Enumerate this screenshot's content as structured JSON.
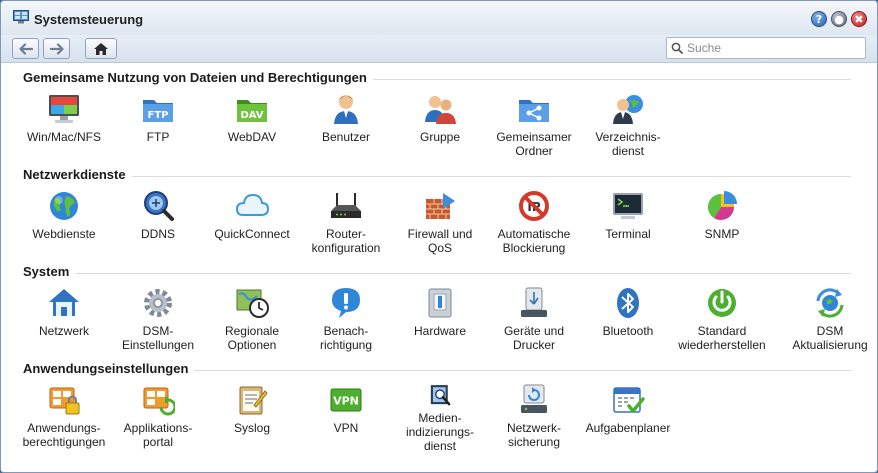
{
  "window": {
    "title": "Systemsteuerung",
    "help_glyph": "?",
    "minimize_glyph": "●",
    "close_glyph": "✖"
  },
  "toolbar": {
    "search_placeholder": "Suche"
  },
  "colors": {
    "accent": "#2a64b0",
    "title_bar": "#dfe7f1",
    "section_line": "#d9dde2"
  },
  "sections": [
    {
      "title": "Gemeinsame Nutzung von Dateien und Berechtigungen",
      "items": [
        {
          "label": "Win/Mac/NFS",
          "icon": "monitor-icon"
        },
        {
          "label": "FTP",
          "icon": "ftp-folder-icon"
        },
        {
          "label": "WebDAV",
          "icon": "dav-folder-icon"
        },
        {
          "label": "Benutzer",
          "icon": "user-icon"
        },
        {
          "label": "Gruppe",
          "icon": "group-icon"
        },
        {
          "label": "Gemeinsamer\nOrdner",
          "icon": "shared-folder-icon"
        },
        {
          "label": "Verzeichnis-\ndienst",
          "icon": "directory-service-icon"
        }
      ]
    },
    {
      "title": "Netzwerkdienste",
      "items": [
        {
          "label": "Webdienste",
          "icon": "globe-icon"
        },
        {
          "label": "DDNS",
          "icon": "ddns-magnifier-icon"
        },
        {
          "label": "QuickConnect",
          "icon": "cloud-icon"
        },
        {
          "label": "Router-\nkonfiguration",
          "icon": "router-icon"
        },
        {
          "label": "Firewall und\nQoS",
          "icon": "firewall-icon"
        },
        {
          "label": "Automatische\nBlockierung",
          "icon": "block-ip-icon"
        },
        {
          "label": "Terminal",
          "icon": "terminal-icon"
        },
        {
          "label": "SNMP",
          "icon": "pie-chart-icon"
        }
      ]
    },
    {
      "title": "System",
      "items": [
        {
          "label": "Netzwerk",
          "icon": "house-icon"
        },
        {
          "label": "DSM-\nEinstellungen",
          "icon": "gear-icon"
        },
        {
          "label": "Regionale\nOptionen",
          "icon": "map-clock-icon"
        },
        {
          "label": "Benach-\nrichtigung",
          "icon": "notification-icon"
        },
        {
          "label": "Hardware",
          "icon": "hardware-icon"
        },
        {
          "label": "Geräte und\nDrucker",
          "icon": "usb-drive-icon"
        },
        {
          "label": "Bluetooth",
          "icon": "bluetooth-icon"
        },
        {
          "label": "Standard\nwiederherstellen",
          "icon": "power-icon"
        },
        {
          "label": "DSM\nAktualisierung",
          "icon": "update-icon"
        }
      ]
    },
    {
      "title": "Anwendungseinstellungen",
      "items": [
        {
          "label": "Anwendungs-\nberechtigungen",
          "icon": "app-privileges-icon"
        },
        {
          "label": "Applikations-\nportal",
          "icon": "app-portal-icon"
        },
        {
          "label": "Syslog",
          "icon": "syslog-icon"
        },
        {
          "label": "VPN",
          "icon": "vpn-icon"
        },
        {
          "label": "Medien-\nindizierungs-\ndienst",
          "icon": "media-index-icon"
        },
        {
          "label": "Netzwerk-\nsicherung",
          "icon": "network-backup-icon"
        },
        {
          "label": "Aufgabenplaner",
          "icon": "calendar-icon"
        }
      ]
    }
  ]
}
